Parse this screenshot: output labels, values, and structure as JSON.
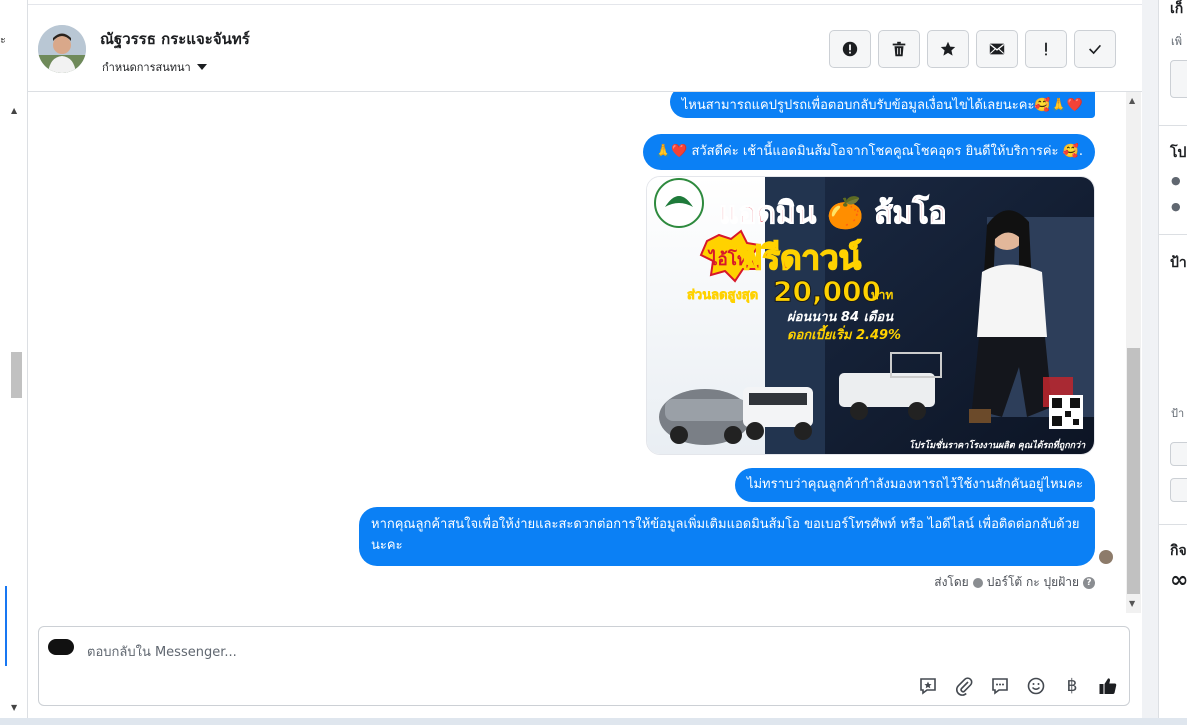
{
  "header": {
    "contact_name": "ณัฐวรรธ กระแจะจันทร์",
    "assign_label": "กำหนดการสนทนา",
    "actions": [
      {
        "name": "spam",
        "icon": "alert-circle-icon"
      },
      {
        "name": "delete",
        "icon": "trash-icon"
      },
      {
        "name": "star",
        "icon": "star-icon"
      },
      {
        "name": "mark-unread",
        "icon": "envelope-icon"
      },
      {
        "name": "important",
        "icon": "exclamation-icon"
      },
      {
        "name": "done",
        "icon": "check-icon"
      }
    ]
  },
  "messages": [
    {
      "text": "ไหนสามารถแคปรูปรถเพื่อตอบกลับรับข้อมูลเงื่อนไขได้เลยนะคะ🥰🙏❤️"
    },
    {
      "text": "🙏❤️ สวัสดีค่ะ เช้านี้แอดมินส้มโอจากโชคคูณโชคอุดร ยินดีให้บริการค่ะ  🥰."
    },
    {
      "text": "ไม่ทราบว่าคุณลูกค้ากำลังมองหารถไว้ใช้งานสักคันอยู่ไหมคะ"
    },
    {
      "text": "หากคุณลูกค้าสนใจเพื่อให้ง่ายและสะดวกต่อการให้ข้อมูลเพิ่มเติมแอดมินส้มโอ ขอเบอร์โทรศัพท์ หรือ ไอดีไลน์ เพื่อติดต่อกลับด้วยนะคะ"
    }
  ],
  "promo": {
    "title": "แอดมิน 🍊 ส้มโอ",
    "badge": "ไอ้โห้",
    "headline": "ฟรีดาวน์",
    "discount_prefix": "ส่วนลดสูงสุด",
    "discount_amount": "20,000",
    "discount_unit": "บาท",
    "installment": "ผ่อนนาน 84 เดือน",
    "interest": "ดอกเบี้ยเริ่ม 2.49%",
    "footer": "โปรโมชั่นราคาโรงงานผลิต คุณได้รถที่ถูกกว่า"
  },
  "sent_by": {
    "prefix": "ส่งโดย",
    "name": "ปอร์โต้ กะ ปุยฝ้าย",
    "help": "?"
  },
  "composer": {
    "placeholder": "ตอบกลับใน Messenger...",
    "tools": [
      {
        "name": "saved-reply",
        "icon": "star-bubble-icon"
      },
      {
        "name": "attach",
        "icon": "paperclip-icon"
      },
      {
        "name": "quick-reply",
        "icon": "chat-bubble-icon"
      },
      {
        "name": "emoji",
        "icon": "smile-icon"
      },
      {
        "name": "payment",
        "icon": "baht-icon",
        "glyph": "฿"
      },
      {
        "name": "like",
        "icon": "thumbs-up-icon"
      }
    ]
  },
  "right_panel": {
    "section1": "เก็",
    "section1_sub": "เพิ่",
    "section2": "โป",
    "section3": "ป้า",
    "section3_sub": "ป้า",
    "section4": "กิจ",
    "infinity": "∞"
  },
  "left_panel": {
    "cut_text": "ะ"
  },
  "colors": {
    "bubble": "#0b80f5",
    "accent": "#1877f2"
  }
}
